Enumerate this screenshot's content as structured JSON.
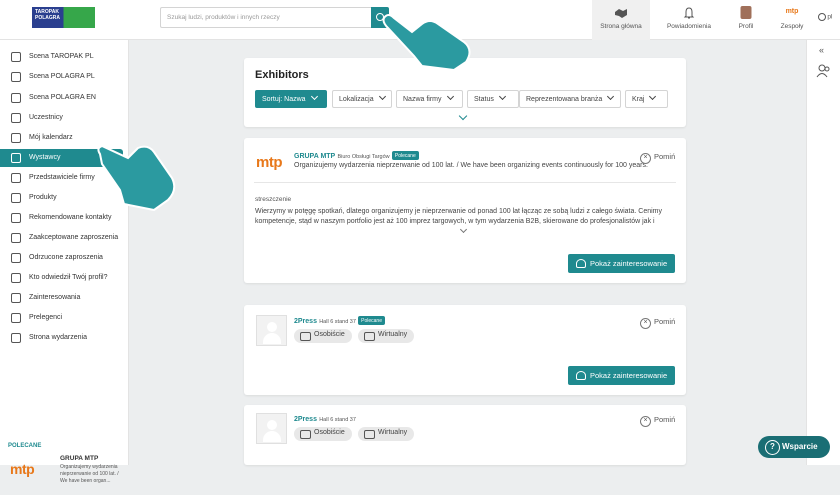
{
  "header": {
    "logo_top": "TAROPAK",
    "logo_mid": "POLAGRA",
    "search_placeholder": "Szukaj ludzi, produktów i innych rzeczy",
    "nav": [
      {
        "label": "Strona główna"
      },
      {
        "label": "Powiadomienia"
      },
      {
        "label": "Profil"
      },
      {
        "label": "Zespoły",
        "logo": "mtp"
      },
      {
        "label": "pl"
      }
    ]
  },
  "sidebar": {
    "items": [
      {
        "label": "Scena TAROPAK PL",
        "icon": "external-link-icon"
      },
      {
        "label": "Scena POLAGRA PL",
        "icon": "external-link-icon"
      },
      {
        "label": "Scena POLAGRA EN",
        "icon": "external-link-icon"
      },
      {
        "label": "Uczestnicy",
        "icon": "users-icon"
      },
      {
        "label": "Mój kalendarz",
        "icon": "calendar-icon"
      },
      {
        "label": "Wystawcy",
        "icon": "booth-icon"
      },
      {
        "label": "Przedstawiciele firmy",
        "icon": "company-icon"
      },
      {
        "label": "Produkty",
        "icon": "box-icon"
      },
      {
        "label": "Rekomendowane kontakty",
        "icon": "star-icon"
      },
      {
        "label": "Zaakceptowane zaproszenia",
        "icon": "handshake-icon"
      },
      {
        "label": "Odrzucone zaproszenia",
        "icon": "reject-icon"
      },
      {
        "label": "Kto odwiedził Twój profil?",
        "icon": "visitor-icon"
      },
      {
        "label": "Zainteresowania",
        "icon": "thumbs-up-icon"
      },
      {
        "label": "Prelegenci",
        "icon": "megaphone-icon"
      },
      {
        "label": "Strona wydarzenia",
        "icon": "megaphone-icon"
      }
    ],
    "polecane_label": "POLECANE",
    "polecane": {
      "logo": "mtp",
      "title": "GRUPA MTP",
      "desc": "Organizujemy wydarzenia nieprzerwanie od 100 lat. / We have been organ..."
    }
  },
  "exhibitors": {
    "title": "Exhibitors",
    "filters": [
      {
        "label": "Sortuj: Nazwa",
        "selected": true
      },
      {
        "label": "Lokalizacja"
      },
      {
        "label": "Nazwa firmy"
      },
      {
        "label": "Status"
      },
      {
        "label": "Reprezentowana branża"
      },
      {
        "label": "Kraj"
      }
    ]
  },
  "cards": [
    {
      "logo": "mtp",
      "name": "GRUPA MTP",
      "sub": "Biuro Obsługi Targów",
      "tag": "Polecane",
      "tagline": "Organizujemy wydarzenia nieprzerwanie od 100 lat. / We have been organizing events continuously for 100 years.",
      "summary_label": "streszczenie",
      "summary": "Wierzymy w potęgę spotkań, dlatego organizujemy je nieprzerwanie od ponad 100 lat łącząc ze sobą ludzi z całego świata. Cenimy kompetencje, stąd w naszym portfolio jest aż 100 imprez targowych, w tym wydarzenia B2B, skierowane do profesjonalistów jak i targi...",
      "skip": "Pomiń",
      "action": "Pokaż zainteresowanie"
    },
    {
      "name": "2Press",
      "sub": "Hall 6 stand 37",
      "tag": "Polecane",
      "chips": [
        "Osobiście",
        "Wirtualny"
      ],
      "skip": "Pomiń",
      "action": "Pokaż zainteresowanie"
    },
    {
      "name": "2Press",
      "sub": "Hall 6 stand 37",
      "chips": [
        "Osobiście",
        "Wirtualny"
      ],
      "skip": "Pomiń"
    }
  ],
  "support": {
    "label": "Wsparcie"
  }
}
